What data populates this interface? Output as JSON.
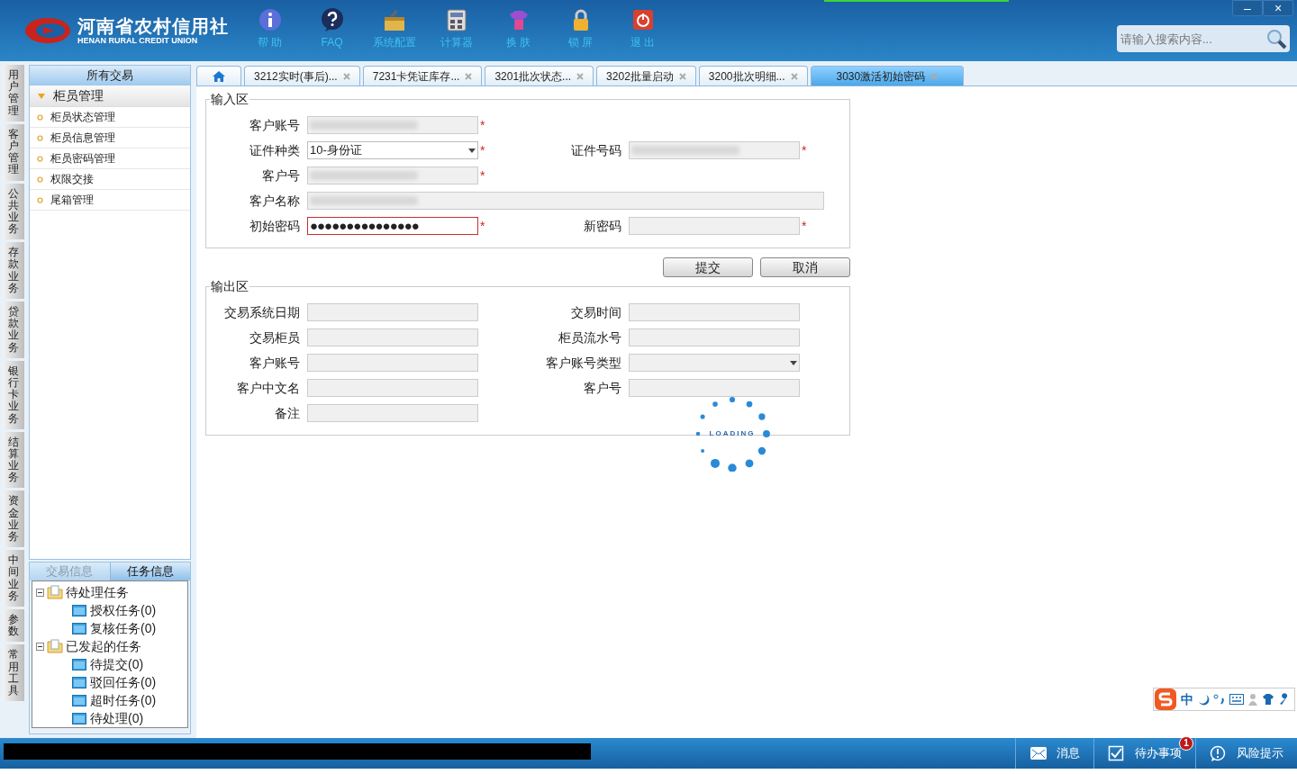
{
  "logo": {
    "title": "河南省农村信用社",
    "subtitle": "HENAN RURAL CREDIT UNION"
  },
  "toolbar": [
    {
      "kind": "info",
      "label": "帮 助"
    },
    {
      "kind": "faq",
      "label": "FAQ"
    },
    {
      "kind": "tools",
      "label": "系统配置"
    },
    {
      "kind": "calc",
      "label": "计算器"
    },
    {
      "kind": "skin",
      "label": "换 肤"
    },
    {
      "kind": "lock",
      "label": "锁 屏"
    },
    {
      "kind": "exit",
      "label": "退 出"
    }
  ],
  "window_controls": [
    "–",
    "×"
  ],
  "search": {
    "placeholder": "请输入搜索内容..."
  },
  "side_tabs": [
    "用户管理",
    "客户管理",
    "公共业务",
    "存款业务",
    "贷款业务",
    "银行卡业务",
    "结算业务",
    "资金业务",
    "中间业务",
    "参数",
    "常用工具"
  ],
  "menu": {
    "header": "所有交易",
    "group": {
      "label": "柜员管理",
      "expanded": true,
      "items": [
        "柜员状态管理",
        "柜员信息管理",
        "柜员密码管理",
        "权限交接",
        "尾箱管理"
      ]
    }
  },
  "info_tabs": [
    {
      "label": "交易信息",
      "selected": false
    },
    {
      "label": "任务信息",
      "selected": true
    }
  ],
  "task_tree": [
    {
      "label": "待处理任务",
      "expanded": true,
      "children": [
        {
          "label": "授权任务(0)"
        },
        {
          "label": "复核任务(0)"
        }
      ]
    },
    {
      "label": "已发起的任务",
      "expanded": true,
      "children": [
        {
          "label": "待提交(0)"
        },
        {
          "label": "驳回任务(0)"
        },
        {
          "label": "超时任务(0)"
        },
        {
          "label": "待处理(0)"
        }
      ]
    }
  ],
  "tabs": [
    {
      "kind": "home",
      "selected": false
    },
    {
      "kind": "page",
      "label": "3212实时(事后)...",
      "selected": false
    },
    {
      "kind": "page",
      "label": "7231卡凭证库存...",
      "selected": false
    },
    {
      "kind": "page",
      "label": "3201批次状态...",
      "selected": false
    },
    {
      "kind": "page",
      "label": "3202批量启动",
      "selected": false
    },
    {
      "kind": "page",
      "label": "3200批次明细...",
      "selected": false
    },
    {
      "kind": "page",
      "label": "3030激活初始密码",
      "selected": true
    }
  ],
  "input_section": {
    "title": "输入区",
    "rows": [
      [
        {
          "label": "客户账号",
          "kind": "text",
          "marker": "*",
          "blurred": true
        }
      ],
      [
        {
          "label": "证件种类",
          "kind": "select",
          "value": "10-身份证",
          "marker": "*"
        },
        {
          "label": "证件号码",
          "kind": "text",
          "marker": "*",
          "blurred": true
        }
      ],
      [
        {
          "label": "客户号",
          "kind": "text",
          "marker": "*",
          "blurred": true
        }
      ],
      [
        {
          "label": "客户名称",
          "kind": "wide",
          "blurred": true
        }
      ],
      [
        {
          "label": "初始密码",
          "kind": "password",
          "value": "●●●●●●●●●●●●●●●",
          "marker": "*",
          "focused": true
        },
        {
          "label": "新密码",
          "kind": "text",
          "marker": "*"
        }
      ]
    ]
  },
  "buttons": [
    "提交",
    "取消"
  ],
  "output_section": {
    "title": "输出区",
    "rows": [
      [
        {
          "label": "交易系统日期",
          "kind": "text"
        },
        {
          "label": "交易时间",
          "kind": "text"
        }
      ],
      [
        {
          "label": "交易柜员",
          "kind": "text"
        },
        {
          "label": "柜员流水号",
          "kind": "text"
        }
      ],
      [
        {
          "label": "客户账号",
          "kind": "text"
        },
        {
          "label": "客户账号类型",
          "kind": "select"
        }
      ],
      [
        {
          "label": "客户中文名",
          "kind": "text"
        },
        {
          "label": "客户号",
          "kind": "text"
        }
      ],
      [
        {
          "label": "备注",
          "kind": "text"
        }
      ]
    ]
  },
  "loading": {
    "label": "LOADING"
  },
  "ime_toolbar": {
    "mode": "中"
  },
  "status_bar": [
    {
      "kind": "message",
      "label": "消息"
    },
    {
      "kind": "todo",
      "label": "待办事项",
      "badge": "1"
    },
    {
      "kind": "risk",
      "label": "风险提示"
    }
  ]
}
